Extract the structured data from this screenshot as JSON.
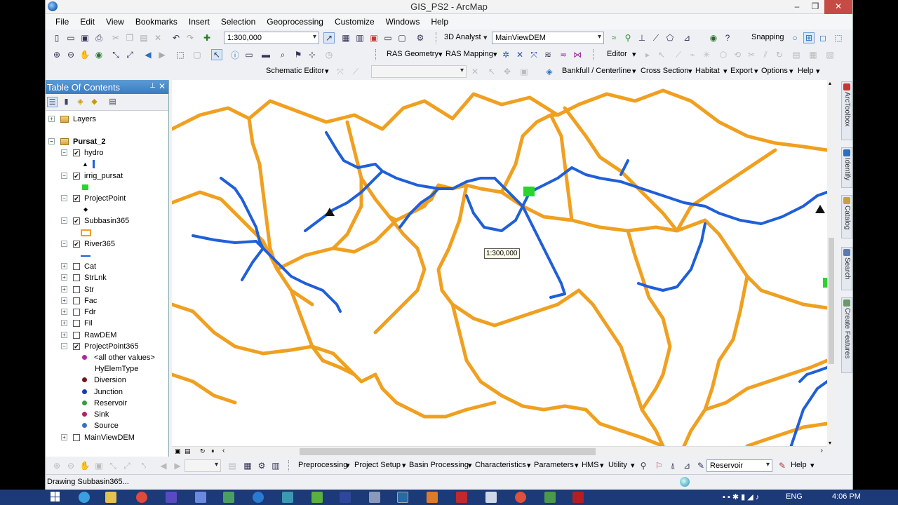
{
  "window": {
    "title": "GIS_PS2 - ArcMap",
    "minimize": "–",
    "maximize": "❐",
    "close": "✕"
  },
  "menu": [
    "File",
    "Edit",
    "View",
    "Bookmarks",
    "Insert",
    "Selection",
    "Geoprocessing",
    "Customize",
    "Windows",
    "Help"
  ],
  "toolbar1": {
    "scale_value": "1:300,000",
    "analyst_3d": "3D Analyst",
    "layer_combo": "MainViewDEM",
    "snapping": "Snapping"
  },
  "toolbar2": {
    "ras_geometry": "RAS Geometry",
    "ras_mapping": "RAS Mapping",
    "editor": "Editor"
  },
  "toolbar3": {
    "schematic": "Schematic Editor",
    "bankfull": "Bankfull / Centerline",
    "cross_section": "Cross Section",
    "habitat": "Habitat",
    "export": "Export",
    "options": "Options",
    "help": "Help"
  },
  "toc": {
    "title": "Table Of Contents",
    "layers_root": "Layers",
    "group": "Pursat_2",
    "layers": [
      {
        "name": "hydro",
        "checked": true
      },
      {
        "name": "irrig_pursat",
        "checked": true
      },
      {
        "name": "ProjectPoint",
        "checked": true
      },
      {
        "name": "Subbasin365",
        "checked": true
      },
      {
        "name": "River365",
        "checked": true
      },
      {
        "name": "Cat",
        "checked": false
      },
      {
        "name": "StrLnk",
        "checked": false
      },
      {
        "name": "Str",
        "checked": false
      },
      {
        "name": "Fac",
        "checked": false
      },
      {
        "name": "Fdr",
        "checked": false
      },
      {
        "name": "Fil",
        "checked": false
      },
      {
        "name": "RawDEM",
        "checked": false
      },
      {
        "name": "ProjectPoint365",
        "checked": true
      },
      {
        "name": "MainViewDEM",
        "checked": false
      }
    ],
    "legend": {
      "all_other": "<all other values>",
      "field": "HyElemType",
      "values": [
        {
          "label": "Diversion",
          "color": "#6b1a1a"
        },
        {
          "label": "Junction",
          "color": "#1d3bb3"
        },
        {
          "label": "Reservoir",
          "color": "#3a9a3a"
        },
        {
          "label": "Sink",
          "color": "#b02266"
        },
        {
          "label": "Source",
          "color": "#3a6fc8"
        }
      ],
      "all_other_color": "#b02a9a"
    }
  },
  "map": {
    "scale_tip": "1:300,000",
    "river_color": "#1f5fd8",
    "subbasin_color": "#f0a020",
    "point_color": "#2ad42a"
  },
  "bottom_toolbar": {
    "items": [
      "Preprocessing",
      "Project Setup",
      "Basin Processing",
      "Characteristics",
      "Parameters",
      "HMS",
      "Utility"
    ],
    "combo": "Reservoir",
    "help": "Help"
  },
  "right_dock": [
    "ArcToolbox",
    "Identify",
    "Catalog",
    "Search",
    "Create Features"
  ],
  "status": {
    "message": "Drawing Subbasin365..."
  },
  "tray": {
    "language": "ENG",
    "time": "4:06 PM"
  }
}
